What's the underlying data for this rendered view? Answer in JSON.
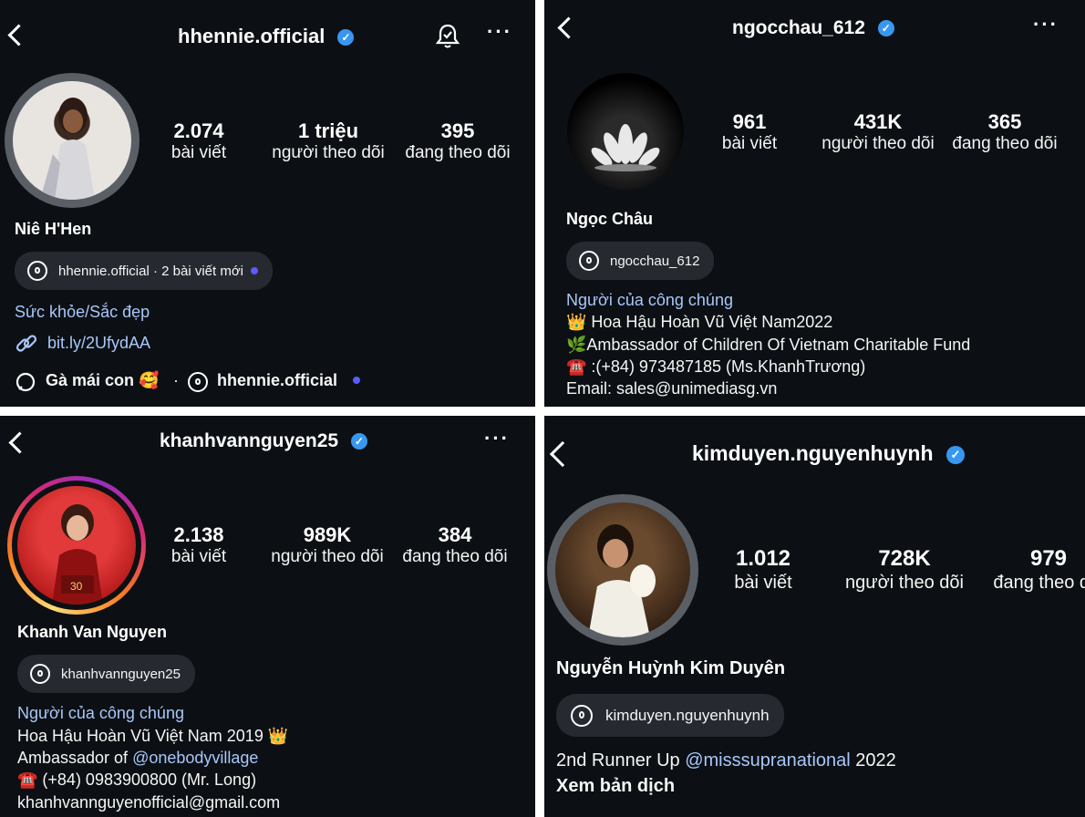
{
  "p1": {
    "username": "hhennie.official",
    "stats": [
      {
        "value": "2.074",
        "label": "bài viết"
      },
      {
        "value": "1 triệu",
        "label": "người theo dõi"
      },
      {
        "value": "395",
        "label": "đang theo dõi"
      }
    ],
    "name": "Niê H'Hen",
    "threads_pill": "hhennie.official · 2 bài viết mới",
    "category": "Sức khỏe/Sắc đẹp",
    "link": "bit.ly/2UfydAA",
    "footer_left": "Gà mái con 🥰",
    "footer_sep": "·",
    "footer_right": "hhennie.official"
  },
  "p2": {
    "username": "ngocchau_612",
    "stats": [
      {
        "value": "961",
        "label": "bài viết"
      },
      {
        "value": "431K",
        "label": "người theo dõi"
      },
      {
        "value": "365",
        "label": "đang theo dõi"
      }
    ],
    "name": "Ngọc Châu",
    "threads_pill": "ngocchau_612",
    "category": "Người của công chúng",
    "bio": [
      "👑 Hoa Hậu Hoàn Vũ Việt Nam2022",
      "🌿Ambassador of Children Of Vietnam Charitable Fund",
      "☎️ :(+84) 973487185 (Ms.KhanhTrương)",
      "Email: sales@unimediasg.vn"
    ]
  },
  "p3": {
    "username": "khanhvannguyen25",
    "stats": [
      {
        "value": "2.138",
        "label": "bài viết"
      },
      {
        "value": "989K",
        "label": "người theo dõi"
      },
      {
        "value": "384",
        "label": "đang theo dõi"
      }
    ],
    "name": "Khanh Van Nguyen",
    "threads_pill": "khanhvannguyen25",
    "category": "Người của công chúng",
    "bio1": "Hoa Hậu Hoàn Vũ Việt Nam 2019 👑",
    "bio2_prefix": "Ambassador of ",
    "bio2_mention": "@onebodyvillage",
    "bio3": "☎️ (+84) 0983900800 (Mr. Long)",
    "bio4": "khanhvannguyenofficial@gmail.com"
  },
  "p4": {
    "username": "kimduyen.nguyenhuynh",
    "stats": [
      {
        "value": "1.012",
        "label": "bài viết"
      },
      {
        "value": "728K",
        "label": "người theo dõi"
      },
      {
        "value": "979",
        "label": "đang theo dõi"
      }
    ],
    "name": "Nguyễn Huỳnh Kim Duyên",
    "threads_pill": "kimduyen.nguyenhuynh",
    "bio1_prefix": "2nd Runner Up ",
    "bio1_mention": "@misssupranational",
    "bio1_suffix": " 2022",
    "translate": "Xem bản dịch"
  },
  "icons": {
    "verified": "✓",
    "more": "···"
  },
  "colors": {
    "background": "#0c1014",
    "verified": "#3897f0",
    "link": "#a8c7fa",
    "pill": "#262a30",
    "new_dot": "#5b5bff"
  }
}
